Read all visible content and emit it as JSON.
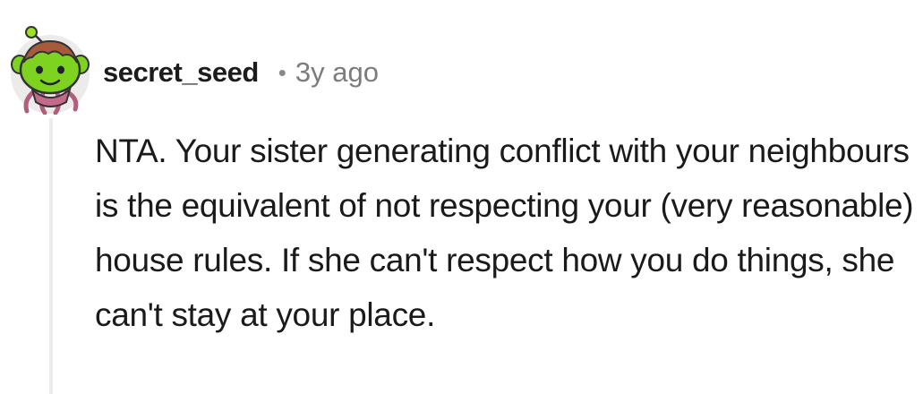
{
  "comment": {
    "author": "secret_seed",
    "separator": "•",
    "timestamp": "3y ago",
    "body": "NTA. Your sister generating conflict with your neighbours is the equivalent of not respecting your (very reasonable) house rules. If she can't respect how you do things, she can't stay at your place.",
    "avatar_icon": "snoo-avatar-icon"
  },
  "colors": {
    "thread_line": "#ececec",
    "avatar_skin": "#7ed321",
    "text": "#1a1a1b",
    "muted": "#7c7c7c"
  }
}
